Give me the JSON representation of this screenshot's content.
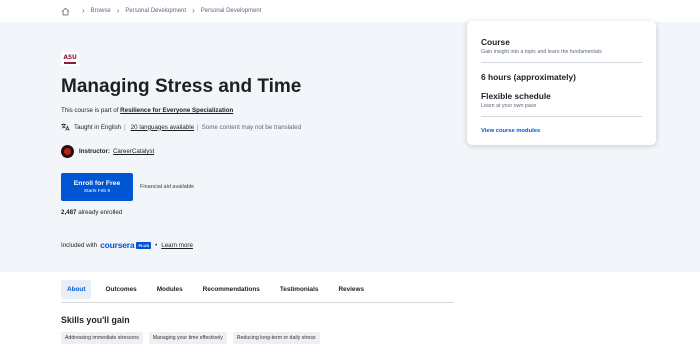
{
  "breadcrumb": {
    "items": [
      "Browse",
      "Personal Development",
      "Personal Development"
    ]
  },
  "course": {
    "title": "Managing Stress and Time",
    "part_of_prefix": "This course is part of ",
    "specialization": "Resilience for Everyone Specialization",
    "taught_in": "Taught in English",
    "languages_link": "20 languages available",
    "translation_note": "Some content may not be translated",
    "instructor_label": "Instructor:",
    "instructor_name": "CareerCatalyst",
    "enroll_label": "Enroll for Free",
    "enroll_sub": "Starts Feb 9",
    "financial_aid": "Financial aid available",
    "enrolled_count": "2,487",
    "enrolled_suffix": " already enrolled",
    "included_with": "Included with",
    "brand": "coursera",
    "brand_badge": "PLUS",
    "learn_more": "Learn more"
  },
  "card": {
    "type": "Course",
    "type_desc": "Gain insight into a topic and learn the fundamentals",
    "hours": "6 hours (approximately)",
    "schedule": "Flexible schedule",
    "schedule_desc": "Learn at your own pace",
    "modules_link": "View course modules"
  },
  "tabs": [
    "About",
    "Outcomes",
    "Modules",
    "Recommendations",
    "Testimonials",
    "Reviews"
  ],
  "skills": {
    "title": "Skills you'll gain",
    "items": [
      "Addressing immediate stressors",
      "Managing your time effectively",
      "Reducing long-term or daily stress"
    ]
  },
  "colors": {
    "brand_blue": "#0056d2",
    "hero_bg": "#f2f5fa",
    "asu_maroon": "#8c1d40"
  },
  "icons": [
    "home-icon",
    "chevron-right-icon",
    "translate-icon"
  ]
}
